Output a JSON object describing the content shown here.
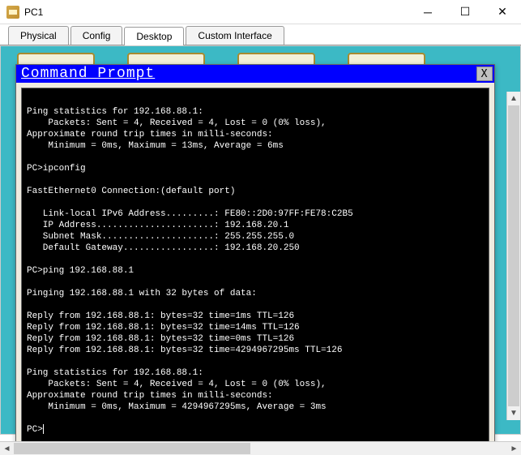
{
  "window": {
    "title": "PC1"
  },
  "tabs": {
    "physical": "Physical",
    "config": "Config",
    "desktop": "Desktop",
    "custom": "Custom Interface"
  },
  "cmd": {
    "title": "Command Prompt",
    "close": "X",
    "lines": [
      "",
      "Ping statistics for 192.168.88.1:",
      "    Packets: Sent = 4, Received = 4, Lost = 0 (0% loss),",
      "Approximate round trip times in milli-seconds:",
      "    Minimum = 0ms, Maximum = 13ms, Average = 6ms",
      "",
      "PC>ipconfig",
      "",
      "FastEthernet0 Connection:(default port)",
      "",
      "   Link-local IPv6 Address.........: FE80::2D0:97FF:FE78:C2B5",
      "   IP Address......................: 192.168.20.1",
      "   Subnet Mask.....................: 255.255.255.0",
      "   Default Gateway.................: 192.168.20.250",
      "",
      "PC>ping 192.168.88.1",
      "",
      "Pinging 192.168.88.1 with 32 bytes of data:",
      "",
      "Reply from 192.168.88.1: bytes=32 time=1ms TTL=126",
      "Reply from 192.168.88.1: bytes=32 time=14ms TTL=126",
      "Reply from 192.168.88.1: bytes=32 time=0ms TTL=126",
      "Reply from 192.168.88.1: bytes=32 time=4294967295ms TTL=126",
      "",
      "Ping statistics for 192.168.88.1:",
      "    Packets: Sent = 4, Received = 4, Lost = 0 (0% loss),",
      "Approximate round trip times in milli-seconds:",
      "    Minimum = 0ms, Maximum = 4294967295ms, Average = 3ms",
      ""
    ],
    "prompt": "PC>"
  }
}
